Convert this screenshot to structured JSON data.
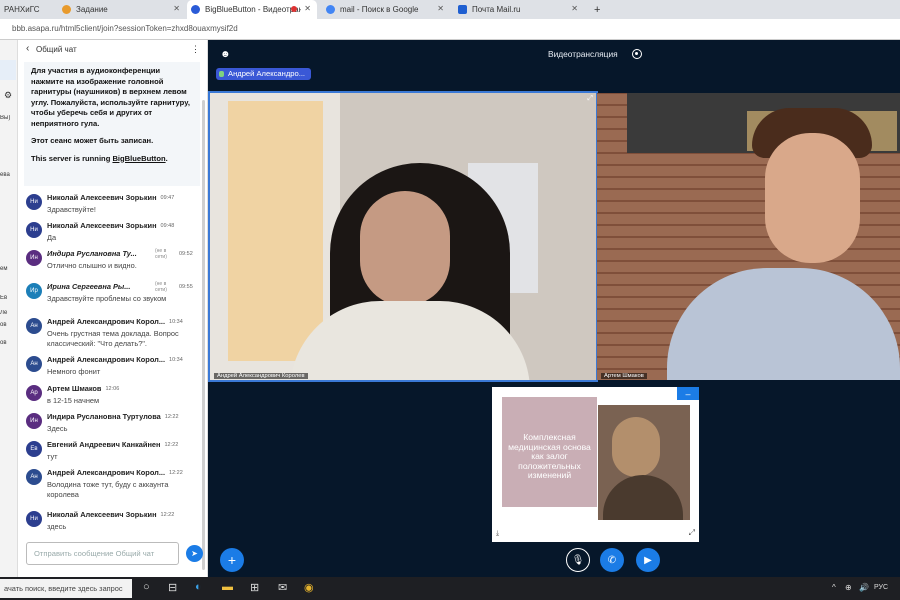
{
  "browser": {
    "tabs": [
      {
        "label": "РАНХиГС",
        "active": false
      },
      {
        "label": "Задание",
        "active": false
      },
      {
        "label": "BigBlueButton - Видеотранс...",
        "active": true
      },
      {
        "label": "mail - Поиск в Google",
        "active": false
      },
      {
        "label": "Почта Mail.ru",
        "active": false
      }
    ],
    "new_tab_label": "+",
    "url": "bbb.asapa.ru/html5client/join?sessionToken=zhxd8ouaxmysif2d"
  },
  "left_strip": {
    "items": [
      "Вы)",
      "ева",
      "ем",
      "Ев",
      "Ле",
      "ов",
      "ов"
    ]
  },
  "chat": {
    "title": "Общий чат",
    "welcome": {
      "line1": "Для участия в аудиоконференции нажмите на изображение головной гарнитуры (наушников) в верхнем левом углу.",
      "line1_bold": "Пожалуйста, используйте гарнитуру, чтобы уберечь себя и других от неприятного гула.",
      "line2": "Этот сеанс может быть записан.",
      "line3_prefix": "This server is running ",
      "line3_link": "BigBlueButton",
      "line3_suffix": "."
    },
    "messages": [
      {
        "initials": "Ни",
        "name": "Николай Алексеевич Зорькин",
        "time": "09:47",
        "status": "",
        "text": "Здравствуйте!",
        "color": "#2c3e8f",
        "italic": false
      },
      {
        "initials": "Ни",
        "name": "Николай Алексеевич Зорькин",
        "time": "09:48",
        "status": "",
        "text": "Да",
        "color": "#2c3e8f",
        "italic": false
      },
      {
        "initials": "Ин",
        "name": "Индира Руслановна Ту...",
        "time": "09:52",
        "status": "(не в сети)",
        "text": "Отлично слышно и видно.",
        "color": "#5a2d80",
        "italic": true
      },
      {
        "initials": "Ир",
        "name": "Ирина Сергеевна Ры...",
        "time": "09:55",
        "status": "(не в сети)",
        "text": "Здравствуйте проблемы со звуком",
        "color": "#1c7fb8",
        "italic": true
      },
      {
        "initials": "Ан",
        "name": "Андрей Александрович Корол...",
        "time": "10:34",
        "status": "",
        "text": "Очень грустная тема доклада. Вопрос классический: \"Что делать?\".",
        "color": "#2c4c8f",
        "italic": false
      },
      {
        "initials": "Ан",
        "name": "Андрей Александрович Корол...",
        "time": "10:34",
        "status": "",
        "text": "Немного фонит",
        "color": "#2c4c8f",
        "italic": false
      },
      {
        "initials": "Ар",
        "name": "Артем Шмаков",
        "time": "12:06",
        "status": "",
        "text": "в 12-15 начнем",
        "color": "#5a2d80",
        "italic": false
      },
      {
        "initials": "Ин",
        "name": "Индира Руслановна Туртулова",
        "time": "12:22",
        "status": "",
        "text": "Здесь",
        "color": "#5a2d80",
        "italic": false
      },
      {
        "initials": "Ев",
        "name": "Евгений Андреевич Канкайнен",
        "time": "12:22",
        "status": "",
        "text": "тут",
        "color": "#2c3e8f",
        "italic": false
      },
      {
        "initials": "Ан",
        "name": "Андрей Александрович Корол...",
        "time": "12:22",
        "status": "",
        "text": "Володина тоже тут, буду с аккаунта королева",
        "color": "#2c4c8f",
        "italic": false
      },
      {
        "initials": "Ни",
        "name": "Николай Алексеевич Зорькин",
        "time": "12:22",
        "status": "",
        "text": "здесь",
        "color": "#2c3e8f",
        "italic": false
      }
    ],
    "input_placeholder": "Отправить сообщение Общий чат",
    "send_icon": "paper-plane-icon"
  },
  "main": {
    "title": "Видеотрансляция",
    "talker": "Андрей Александро...",
    "videos": [
      {
        "label": "Андрей Александрович Королев"
      },
      {
        "label": "Артем Шмаков"
      }
    ],
    "presentation": {
      "slide_text": "Комплексная медицинская основа как залог положительных изменений",
      "minimize_label": "–"
    }
  },
  "taskbar": {
    "search_text": "ачать поиск, введите здесь запрос",
    "time_items": [
      "^",
      "⊕",
      "🔊",
      "РУС"
    ]
  },
  "colors": {
    "accent": "#1b7ce6",
    "main_bg": "#06172a",
    "talker_bg": "#3a58d6"
  }
}
